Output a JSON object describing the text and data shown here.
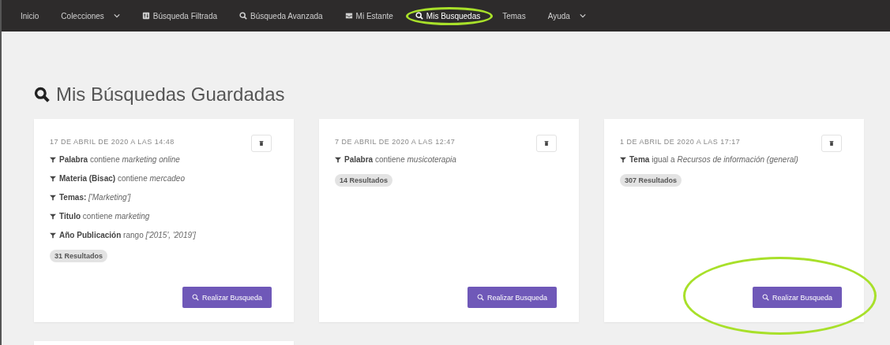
{
  "nav": {
    "items": [
      {
        "label": "Inicio",
        "dropdown": false,
        "selected": false,
        "circled": false
      },
      {
        "label": "Colecciones",
        "dropdown": true,
        "selected": false,
        "circled": false
      },
      {
        "label": "Búsqueda Filtrada",
        "dropdown": false,
        "selected": false,
        "circled": false
      },
      {
        "label": "Búsqueda Avanzada",
        "dropdown": false,
        "selected": false,
        "circled": false
      },
      {
        "label": "Mi Estante",
        "dropdown": false,
        "selected": false,
        "circled": false
      },
      {
        "label": "Mis Busquedas",
        "dropdown": false,
        "selected": true,
        "circled": true
      },
      {
        "label": "Temas",
        "dropdown": false,
        "selected": false,
        "circled": false
      },
      {
        "label": "Ayuda",
        "dropdown": true,
        "selected": false,
        "circled": false
      }
    ]
  },
  "page": {
    "title": "Mis Búsquedas Guardadas"
  },
  "cards": [
    {
      "date": "17 DE ABRIL DE 2020 A LAS 14:48",
      "filters": [
        {
          "field": "Palabra",
          "operator": "contiene",
          "value": "marketing online"
        },
        {
          "field": "Materia (Bisac)",
          "operator": "contiene",
          "value": "mercadeo"
        },
        {
          "field": "Temas:",
          "value": "['Marketing']"
        },
        {
          "field": "Titulo",
          "operator": "contiene",
          "value": "marketing"
        },
        {
          "field": "Año Publicación",
          "operator": "rango",
          "value": "['2015', '2019']"
        }
      ],
      "results": "31 Resultados",
      "button": "Realizar Busqueda",
      "circled": false
    },
    {
      "date": "7 DE ABRIL DE 2020 A LAS 12:47",
      "filters": [
        {
          "field": "Palabra",
          "operator": "contiene",
          "value": "musicoterapia"
        }
      ],
      "results": "14 Resultados",
      "button": "Realizar Busqueda",
      "circled": false
    },
    {
      "date": "1 DE ABRIL DE 2020 A LAS 17:17",
      "filters": [
        {
          "field": "Tema",
          "operator": "igual a",
          "value": "Recursos de información (general)"
        }
      ],
      "results": "307 Resultados",
      "button": "Realizar Busqueda",
      "circled": true
    }
  ],
  "partial_card": true
}
